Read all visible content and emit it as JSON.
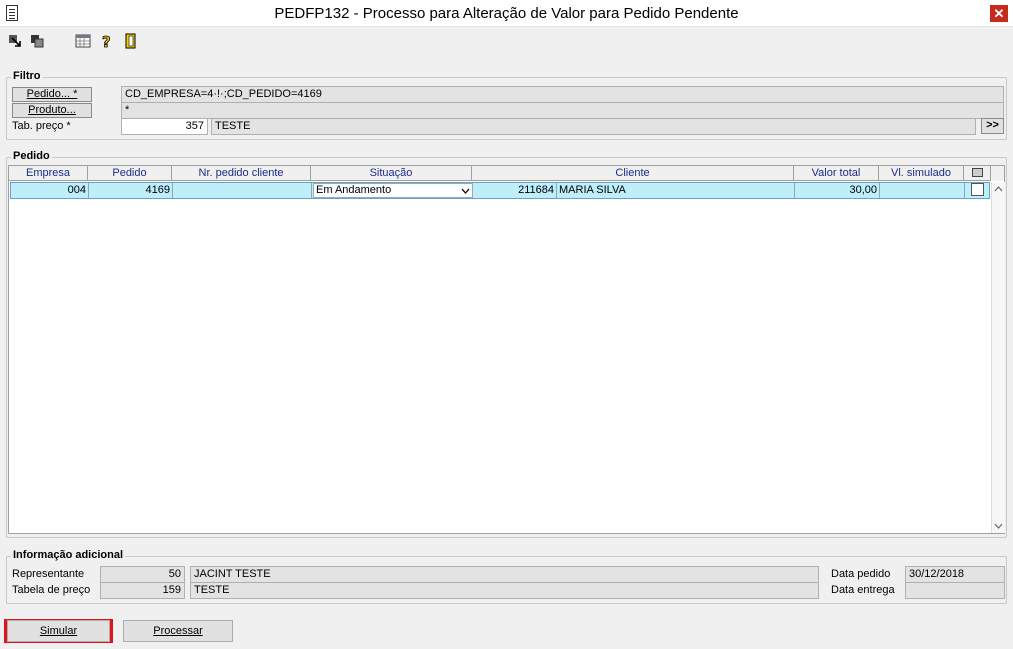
{
  "window": {
    "title": "PEDFP132 - Processo para Alteração de Valor para Pedido Pendente",
    "close_glyph": "✕"
  },
  "toolbar": {
    "icons": [
      "arrow-icon",
      "copy-icon",
      "grid-icon",
      "help-icon",
      "exit-icon"
    ]
  },
  "filtro": {
    "legend": "Filtro",
    "pedido_btn": "Pedido... *",
    "pedido_value": "CD_EMPRESA=4·!·;CD_PEDIDO=4169",
    "produto_btn": "Produto...",
    "produto_value": "*",
    "tab_preco_label": "Tab. preço *",
    "tab_preco_code": "357",
    "tab_preco_desc": "TESTE",
    "more_btn": ">>"
  },
  "pedido": {
    "legend": "Pedido",
    "columns": [
      "Empresa",
      "Pedido",
      "Nr. pedido cliente",
      "Situação",
      "Cliente",
      "Valor total",
      "Vl. simulado"
    ],
    "rows": [
      {
        "empresa": "004",
        "pedido": "4169",
        "nr_pedido_cliente": "",
        "situacao": "Em Andamento",
        "cliente_codigo": "211684",
        "cliente_nome": "MARIA SILVA",
        "valor_total": "30,00",
        "vl_simulado": ""
      }
    ]
  },
  "info": {
    "legend": "Informação adicional",
    "representante_label": "Representante",
    "representante_code": "50",
    "representante_name": "JACINT TESTE",
    "tabela_label": "Tabela de preço",
    "tabela_code": "159",
    "tabela_name": "TESTE",
    "data_pedido_label": "Data pedido",
    "data_pedido_value": "30/12/2018",
    "data_entrega_label": "Data entrega",
    "data_entrega_value": ""
  },
  "buttons": {
    "simular": "Simular",
    "processar": "Processar"
  },
  "colors": {
    "row_selected": "#bfeefb",
    "highlight": "#e0141a",
    "header_text": "#1a2b8c"
  }
}
